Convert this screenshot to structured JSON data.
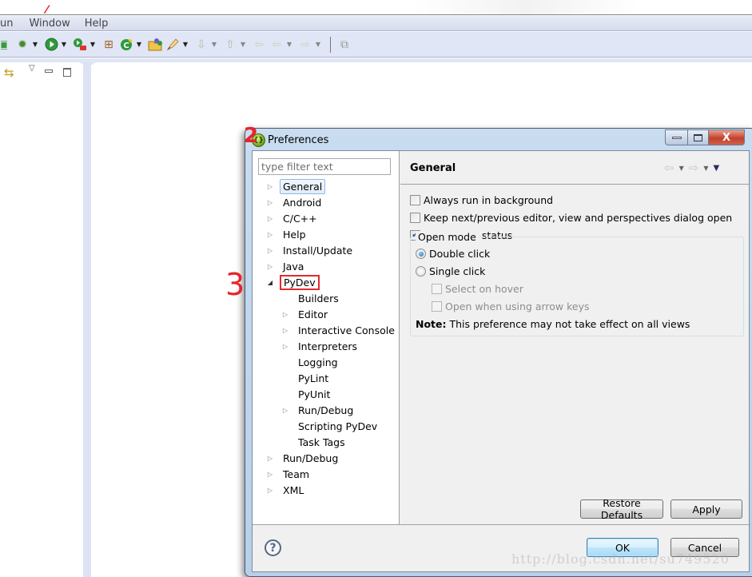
{
  "menubar": {
    "items": [
      {
        "label": "un"
      },
      {
        "label": "Window"
      },
      {
        "label": "Help"
      }
    ]
  },
  "toolbar": {
    "icons": [
      "new-wizard-icon",
      "debug-icon",
      "run-icon",
      "external-tools-icon",
      "new-project-icon",
      "new-class-icon",
      "open-type-icon",
      "search-icon",
      "next-annotation-icon",
      "previous-annotation-icon",
      "last-edit-location-icon",
      "back-icon",
      "forward-icon",
      "pin-editor-icon"
    ]
  },
  "left_view": {
    "icons": [
      "link-with-editor-icon",
      "view-menu-icon",
      "minimize-icon",
      "maximize-icon"
    ]
  },
  "annotations": {
    "one": "/",
    "two": "2",
    "three": "3"
  },
  "dialog": {
    "title": "Preferences",
    "window_buttons": {
      "minimize": "—",
      "maximize": "▭",
      "close": "X"
    },
    "filter": {
      "placeholder": "type filter text",
      "value": ""
    },
    "tree": [
      {
        "label": "General",
        "level": 0,
        "twisty": "collapsed",
        "selected": true
      },
      {
        "label": "Android",
        "level": 0,
        "twisty": "collapsed"
      },
      {
        "label": "C/C++",
        "level": 0,
        "twisty": "collapsed"
      },
      {
        "label": "Help",
        "level": 0,
        "twisty": "collapsed"
      },
      {
        "label": "Install/Update",
        "level": 0,
        "twisty": "collapsed"
      },
      {
        "label": "Java",
        "level": 0,
        "twisty": "collapsed"
      },
      {
        "label": "PyDev",
        "level": 0,
        "twisty": "expanded",
        "highlighted": true
      },
      {
        "label": "Builders",
        "level": 1,
        "twisty": "none"
      },
      {
        "label": "Editor",
        "level": 1,
        "twisty": "collapsed"
      },
      {
        "label": "Interactive Console",
        "level": 1,
        "twisty": "collapsed"
      },
      {
        "label": "Interpreters",
        "level": 1,
        "twisty": "collapsed"
      },
      {
        "label": "Logging",
        "level": 1,
        "twisty": "none"
      },
      {
        "label": "PyLint",
        "level": 1,
        "twisty": "none"
      },
      {
        "label": "PyUnit",
        "level": 1,
        "twisty": "none"
      },
      {
        "label": "Run/Debug",
        "level": 1,
        "twisty": "collapsed"
      },
      {
        "label": "Scripting PyDev",
        "level": 1,
        "twisty": "none"
      },
      {
        "label": "Task Tags",
        "level": 1,
        "twisty": "none"
      },
      {
        "label": "Run/Debug",
        "level": 0,
        "twisty": "collapsed"
      },
      {
        "label": "Team",
        "level": 0,
        "twisty": "collapsed"
      },
      {
        "label": "XML",
        "level": 0,
        "twisty": "collapsed"
      }
    ],
    "page": {
      "title": "General",
      "options": [
        {
          "label": "Always run in background",
          "checked": false
        },
        {
          "label": "Keep next/previous editor, view and perspectives dialog open",
          "checked": false
        },
        {
          "label": "Show heap status",
          "checked": true
        }
      ],
      "open_mode": {
        "legend": "Open mode",
        "double_click": {
          "label": "Double click",
          "selected": true
        },
        "single_click": {
          "label": "Single click",
          "selected": false
        },
        "select_on_hover": {
          "label": "Select on hover",
          "checked": false,
          "enabled": false
        },
        "open_arrow_keys": {
          "label": "Open when using arrow keys",
          "checked": false,
          "enabled": false
        },
        "note_bold": "Note:",
        "note_text": " This preference may not take effect on all views"
      },
      "restore_defaults_label": "Restore Defaults",
      "apply_label": "Apply"
    },
    "ok_label": "OK",
    "cancel_label": "Cancel",
    "help_symbol": "?"
  },
  "watermark": "http://blog.csdn.net/su749520"
}
